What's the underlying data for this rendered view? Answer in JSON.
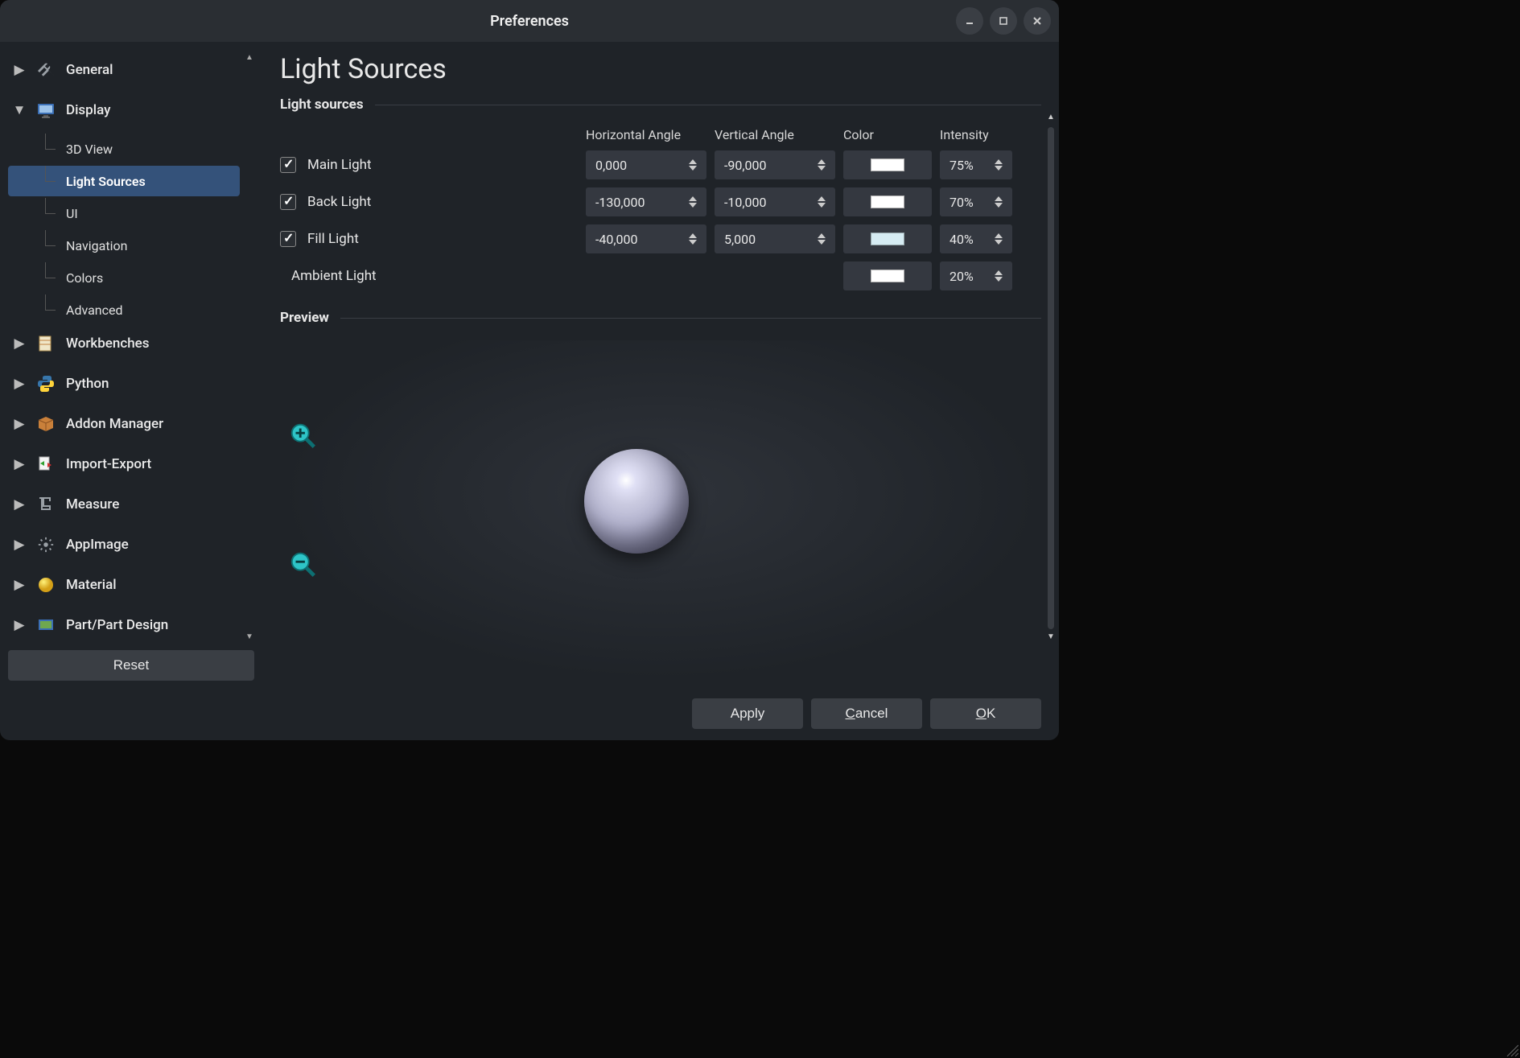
{
  "window": {
    "title": "Preferences"
  },
  "sidebar": {
    "items": [
      {
        "label": "General",
        "expanded": false
      },
      {
        "label": "Display",
        "expanded": true,
        "children": [
          {
            "label": "3D View"
          },
          {
            "label": "Light Sources",
            "selected": true
          },
          {
            "label": "UI"
          },
          {
            "label": "Navigation"
          },
          {
            "label": "Colors"
          },
          {
            "label": "Advanced"
          }
        ]
      },
      {
        "label": "Workbenches",
        "expanded": false
      },
      {
        "label": "Python",
        "expanded": false
      },
      {
        "label": "Addon Manager",
        "expanded": false
      },
      {
        "label": "Import-Export",
        "expanded": false
      },
      {
        "label": "Measure",
        "expanded": false
      },
      {
        "label": "AppImage",
        "expanded": false
      },
      {
        "label": "Material",
        "expanded": false
      },
      {
        "label": "Part/Part Design",
        "expanded": false
      }
    ],
    "reset_label": "Reset"
  },
  "page": {
    "title": "Light Sources",
    "section1": "Light sources",
    "section2": "Preview",
    "columns": {
      "hangle": "Horizontal Angle",
      "vangle": "Vertical Angle",
      "color": "Color",
      "intensity": "Intensity"
    },
    "rows": [
      {
        "name": "Main Light",
        "checked": true,
        "hangle": "0,000",
        "vangle": "-90,000",
        "color": "#ffffff",
        "intensity": "75%"
      },
      {
        "name": "Back Light",
        "checked": true,
        "hangle": "-130,000",
        "vangle": "-10,000",
        "color": "#ffffff",
        "intensity": "70%"
      },
      {
        "name": "Fill Light",
        "checked": true,
        "hangle": "-40,000",
        "vangle": "5,000",
        "color": "#d6ecf3",
        "intensity": "40%"
      }
    ],
    "ambient": {
      "name": "Ambient Light",
      "color": "#ffffff",
      "intensity": "20%"
    }
  },
  "footer": {
    "apply": "Apply",
    "cancel": "Cancel",
    "ok": "OK"
  }
}
